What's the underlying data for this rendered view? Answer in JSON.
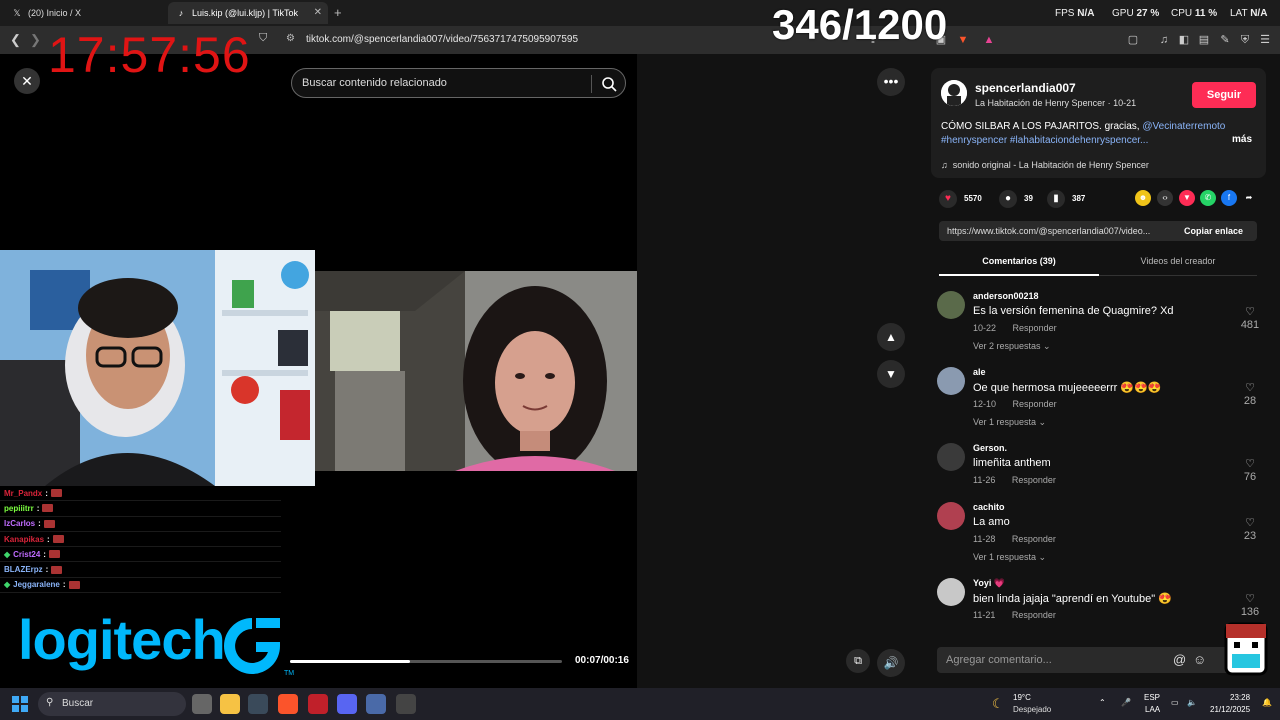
{
  "browser": {
    "tabs": [
      {
        "title": "(20) Inicio / X",
        "icon": "x-logo-icon"
      },
      {
        "title": "Luis.kip (@lui.kljp) | TikTok",
        "icon": "tiktok-icon"
      }
    ],
    "new_tab": "+",
    "url": "tiktok.com/@spencerlandia007/video/7563717475095907595"
  },
  "overlay": {
    "clock": "17:57:56",
    "counter": "346/1200",
    "stats": {
      "fps_label": "FPS",
      "fps": "N/A",
      "gpu_label": "GPU",
      "gpu": "27 %",
      "cpu_label": "CPU",
      "cpu": "11 %",
      "lat_label": "LAT",
      "lat": "N/A"
    }
  },
  "video": {
    "search_placeholder": "Buscar contenido relacionado",
    "progress": 0.44,
    "time": "00:07/00:16"
  },
  "chat": [
    {
      "user": "Mr_Pandx",
      "color": "#d9243a"
    },
    {
      "user": "pepiiitrr",
      "color": "#7cff40"
    },
    {
      "user": "IzCarlos",
      "color": "#c06cff"
    },
    {
      "user": "Kanapikas",
      "color": "#d9243a"
    },
    {
      "user": "Crist24",
      "color": "#c06cff",
      "badge": true
    },
    {
      "user": "BLAZErpz",
      "color": "#8ab4f8"
    },
    {
      "user": "Jeggaralene",
      "color": "#8ab4f8",
      "badge": true
    }
  ],
  "brand": {
    "logo": "logitech",
    "tm": "TM"
  },
  "post": {
    "author": "spencerlandia007",
    "subtitle": "La Habitación de Henry Spencer · 10-21",
    "follow": "Seguir",
    "desc_text": "CÓMO SILBAR A LOS PAJARITOS. gracias, ",
    "desc_mention": "@Vecinaterremoto",
    "desc_tags": "#henryspencer #lahabitaciondehenryspencer...",
    "more": "más",
    "sound": "sonido original - La Habitación de Henry Spencer",
    "likes": "5570",
    "comments": "39",
    "saves": "387",
    "link": "https://www.tiktok.com/@spencerlandia007/video...",
    "copy_link": "Copiar enlace",
    "tab_comments": "Comentarios (39)",
    "tab_videos": "Videos del creador"
  },
  "comments": [
    {
      "user": "anderson00218",
      "text": "Es la versión femenina de Quagmire? Xd",
      "date": "10-22",
      "reply": "Responder",
      "likes": "481",
      "replies": "Ver 2 respuestas ⌄",
      "avatar": "#5a6a4a"
    },
    {
      "user": "ale",
      "text": "Oe que hermosa mujeeeeerrr 😍😍😍",
      "date": "12-10",
      "reply": "Responder",
      "likes": "28",
      "replies": "Ver 1 respuesta ⌄",
      "avatar": "#8a9ab0"
    },
    {
      "user": "Gerson.",
      "text": "limeñita anthem",
      "date": "11-26",
      "reply": "Responder",
      "likes": "76",
      "replies": "",
      "avatar": "#3a3a3a"
    },
    {
      "user": "cachito",
      "text": "La amo",
      "date": "11-28",
      "reply": "Responder",
      "likes": "23",
      "replies": "Ver 1 respuesta ⌄",
      "avatar": "#b04050"
    },
    {
      "user": "Yoyi 💗",
      "text": "bien linda jajaja \"aprendí en Youtube\" 😍",
      "date": "11-21",
      "reply": "Responder",
      "likes": "136",
      "replies": "",
      "avatar": "#c8c8c8"
    }
  ],
  "compose_placeholder": "Agregar comentario...",
  "taskbar": {
    "search": "Buscar",
    "temp": "19°C",
    "weather": "Despejado",
    "lang1": "ESP",
    "lang2": "LAA",
    "time": "23:28",
    "date": "21/12/2025"
  }
}
